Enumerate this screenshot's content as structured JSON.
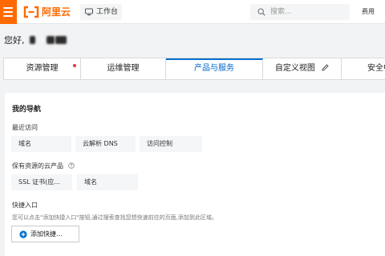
{
  "header": {
    "logo_text": "阿里云",
    "workbench_label": "工作台",
    "search_placeholder": "搜索...",
    "fee_label": "费用",
    "icons": [
      "menu-icon",
      "aliyun-logo-icon",
      "workbench-icon",
      "search-icon"
    ],
    "brand_color": "#ff6a00"
  },
  "greeting": {
    "text": "您好,"
  },
  "tabs": {
    "items": [
      {
        "label": "资源管理",
        "notification_dot": true
      },
      {
        "label": "运维管理"
      },
      {
        "label": "产品与服务",
        "active": true
      },
      {
        "label": "自定义视图",
        "icon": "edit-icon"
      },
      {
        "label": "安全中"
      }
    ],
    "active_color": "#0064c8"
  },
  "navigation": {
    "title": "我的导航",
    "recent": {
      "label": "最近访问",
      "items": [
        "域名",
        "云解析 DNS",
        "访问控制"
      ]
    },
    "owned": {
      "label": "保有资源的云产品",
      "help_icon": "help-icon",
      "items": [
        "SSL 证书(应...",
        "域名"
      ]
    },
    "shortcuts": {
      "label": "快捷入口",
      "hint": "您可以点击\"添加快捷入口\"按钮,通过搜索查找您想快速前往的页面,添加到此区域。",
      "add_button": "添加快捷..."
    }
  }
}
